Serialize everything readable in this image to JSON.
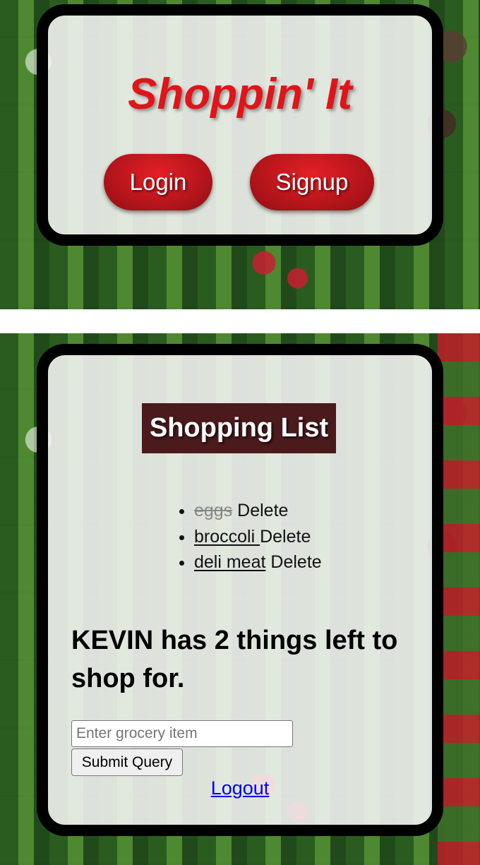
{
  "header": {
    "title": "Shoppin' It",
    "login_label": "Login",
    "signup_label": "Signup"
  },
  "shopping": {
    "heading": "Shopping List",
    "items": [
      {
        "name": "eggs",
        "completed": true,
        "delete_label": "Delete"
      },
      {
        "name": "broccoli ",
        "completed": false,
        "delete_label": "Delete"
      },
      {
        "name": "deli meat",
        "completed": false,
        "delete_label": "Delete"
      }
    ],
    "summary": "KEVIN has 2 things left to shop for.",
    "input_placeholder": "Enter grocery item",
    "input_value": "",
    "submit_label": "Submit Query",
    "logout_label": "Logout"
  },
  "colors": {
    "brand_red": "#e1141a",
    "heading_bg": "#4a1a1d",
    "link_blue": "#0000ee"
  }
}
